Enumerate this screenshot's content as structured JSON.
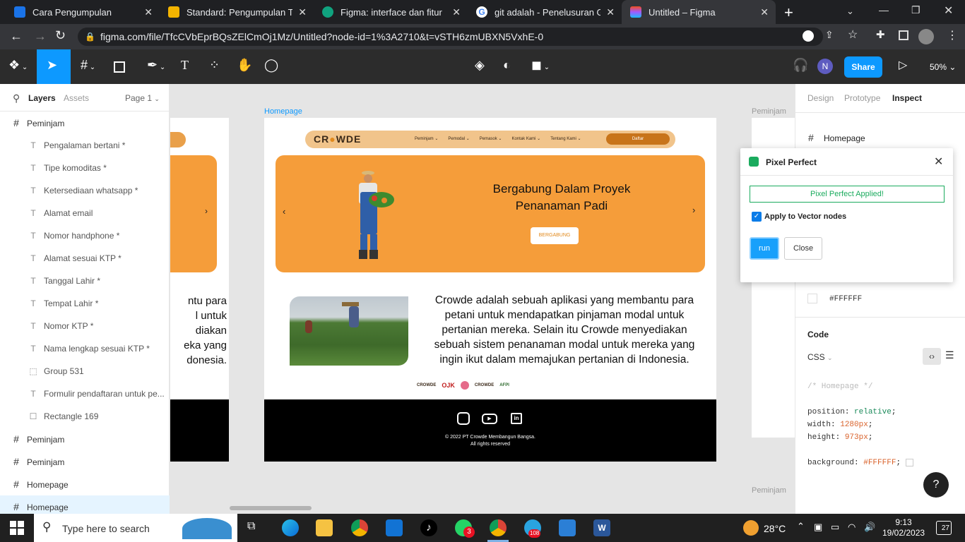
{
  "browser": {
    "tabs": [
      {
        "title": "Cara Pengumpulan",
        "color": "#1a73e8"
      },
      {
        "title": "Standard: Pengumpulan Tug",
        "color": "#f4b400"
      },
      {
        "title": "Figma: interface dan fitur",
        "color": "#10a37f"
      },
      {
        "title": "git adalah - Penelusuran Goo",
        "color": "#ffffff"
      },
      {
        "title": "Untitled – Figma",
        "color": "#f24e1e"
      }
    ],
    "new_tab": "+",
    "url": "figma.com/file/TfcCVbEprBQsZElCmOj1Mz/Untitled?node-id=1%3A2710&t=vSTH6zmUBXN5VxhE-0"
  },
  "figma": {
    "avatar": "N",
    "share": "Share",
    "zoom": "50%",
    "left": {
      "tab_layers": "Layers",
      "tab_assets": "Assets",
      "page": "Page 1",
      "layers": [
        {
          "icon": "#",
          "label": "Peminjam",
          "level": 0
        },
        {
          "icon": "T",
          "label": "Pengalaman bertani *",
          "level": 1
        },
        {
          "icon": "T",
          "label": "Tipe komoditas *",
          "level": 1
        },
        {
          "icon": "T",
          "label": "Ketersediaan whatsapp *",
          "level": 1
        },
        {
          "icon": "T",
          "label": "Alamat email",
          "level": 1
        },
        {
          "icon": "T",
          "label": "Nomor handphone *",
          "level": 1
        },
        {
          "icon": "T",
          "label": "Alamat sesuai KTP *",
          "level": 1
        },
        {
          "icon": "T",
          "label": "Tanggal Lahir *",
          "level": 1
        },
        {
          "icon": "T",
          "label": "Tempat Lahir *",
          "level": 1
        },
        {
          "icon": "T",
          "label": "Nomor KTP *",
          "level": 1
        },
        {
          "icon": "T",
          "label": "Nama lengkap sesuai KTP *",
          "level": 1
        },
        {
          "icon": "⬚",
          "label": "Group 531",
          "level": 1
        },
        {
          "icon": "T",
          "label": "Formulir pendaftaran untuk pe...",
          "level": 1
        },
        {
          "icon": "☐",
          "label": "Rectangle 169",
          "level": 1
        },
        {
          "icon": "#",
          "label": "Peminjam",
          "level": 0
        },
        {
          "icon": "#",
          "label": "Peminjam",
          "level": 0
        },
        {
          "icon": "#",
          "label": "Homepage",
          "level": 0
        },
        {
          "icon": "#",
          "label": "Homepage",
          "level": 0
        }
      ]
    },
    "canvas": {
      "frame_label": "Homepage",
      "side_label_top": "Peminjam",
      "side_label_bottom": "Peminjam",
      "nav": {
        "logo": "CR  WDE",
        "items": [
          "Peminjam ⌄",
          "Pemodal ⌄",
          "Pemasok ⌄",
          "Kontak Kami ⌄",
          "Tentang Kami ⌄"
        ],
        "cta": "Daftar"
      },
      "hero": {
        "title": "Bergabung Dalam Proyek Penanaman Padi",
        "button": "BERGABUNG"
      },
      "about": "Crowde adalah sebuah aplikasi yang membantu para petani untuk mendapatkan pinjaman modal untuk pertanian mereka. Selain itu Crowde menyediakan sebuah sistem penanaman modal untuk mereka yang ingin ikut dalam memajukan pertanian di Indonesia.",
      "partners": [
        "CROWDE",
        "OJK",
        "CROWDE",
        "AFPI"
      ],
      "footer": {
        "copyright": "© 2022 PT Crowde Membangun Bangsa.",
        "rights": "All rights reserved"
      },
      "left_frame_text": [
        "ntu para",
        "l untuk",
        "diakan",
        "eka yang",
        "donesia."
      ]
    },
    "right": {
      "tabs": [
        "Design",
        "Prototype",
        "Inspect"
      ],
      "selected": "Homepage",
      "fill": "#FFFFFF",
      "code_title": "Code",
      "lang": "CSS",
      "code": [
        {
          "t": "comment",
          "v": "/* Homepage */"
        },
        {
          "k": "position",
          "v": "relative"
        },
        {
          "k": "width",
          "v": "1280px"
        },
        {
          "k": "height",
          "v": "973px"
        },
        {
          "k": "background",
          "v": "#FFFFFF"
        }
      ],
      "help": "?"
    },
    "plugin": {
      "title": "Pixel Perfect",
      "status": "Pixel Perfect Applied!",
      "checkbox_label": "Apply to Vector nodes",
      "checked": true,
      "run": "run",
      "close": "Close"
    }
  },
  "taskbar": {
    "search": "Type here to search",
    "weather": "28°C",
    "time": "9:13",
    "date": "19/02/2023",
    "notif": "27",
    "whatsapp_badge": "3",
    "telegram_badge": "108"
  }
}
